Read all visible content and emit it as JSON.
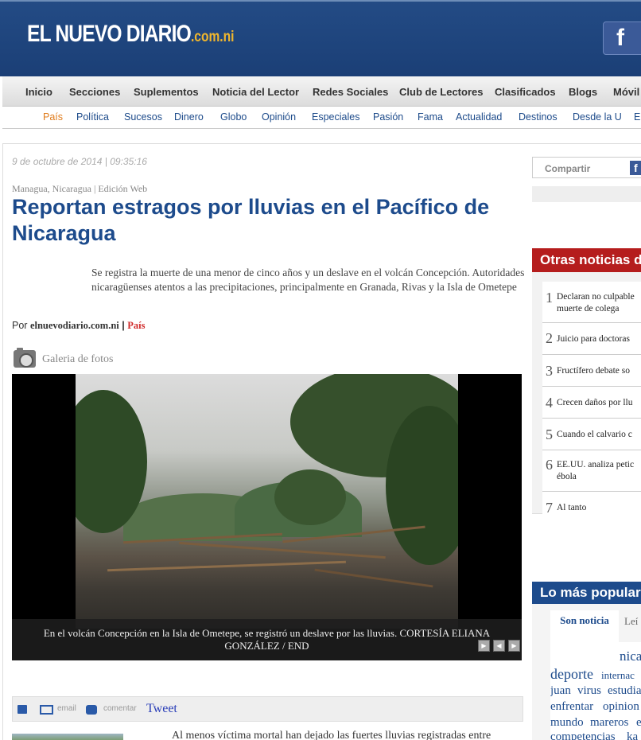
{
  "header": {
    "logo_main": "EL NUEVO DIARIO",
    "logo_domain": ".com.ni",
    "facebook_glyph": "f"
  },
  "main_nav": [
    "Inicio",
    "Secciones",
    "Suplementos",
    "Noticia del Lector",
    "Redes Sociales",
    "Club de Lectores",
    "Clasificados",
    "Blogs",
    "Móvil"
  ],
  "sub_nav": [
    "País",
    "Política",
    "Sucesos",
    "Dinero",
    "Globo",
    "Opinión",
    "Especiales",
    "Pasión",
    "Fama",
    "Actualidad",
    "Destinos",
    "Desde la U",
    "En"
  ],
  "sub_nav_active": "País",
  "article": {
    "date": "9 de octubre de 2014 | 09:35:16",
    "location": "Managua, Nicaragua | Edición Web",
    "headline": "Reportan estragos por lluvias en el Pacífico de Nicaragua",
    "summary": "Se registra la muerte de una menor de cinco años y un deslave en el volcán Concepción. Autoridades nicaragüenses atentos a las precipitaciones, principalmente en Granada, Rivas y la Isla de Ometepe",
    "byline_prefix": "Por",
    "byline_site": "elnuevodiario.com.ni",
    "byline_sep": "|",
    "byline_section": "País",
    "gallery_label": "Galeria de fotos",
    "caption": "En el volcán Concepción en la Isla de Ometepe, se registró un deslave por las lluvias. CORTESÍA ELIANA GONZÁLEZ / END",
    "body_start": "Al menos víctima mortal han dejado las fuertes lluvias registradas entre"
  },
  "share_bar": {
    "email": "email",
    "comment": "comentar",
    "tweet": "Tweet"
  },
  "sidebar": {
    "share_label": "Compartir",
    "share_fb": "f",
    "otras_title": "Otras noticias d",
    "otras": [
      {
        "num": "1",
        "text_line1": "Declaran no culpable",
        "text_line2": "muerte de colega"
      },
      {
        "num": "2",
        "text_line1": "Juicio para doctoras",
        "text_line2": ""
      },
      {
        "num": "3",
        "text_line1": "Fructífero debate so",
        "text_line2": ""
      },
      {
        "num": "4",
        "text_line1": "Crecen daños por llu",
        "text_line2": ""
      },
      {
        "num": "5",
        "text_line1": "Cuando el calvario c",
        "text_line2": ""
      },
      {
        "num": "6",
        "text_line1": "EE.UU. analiza petic",
        "text_line2": "ébola"
      },
      {
        "num": "7",
        "text_line1": "Al tanto",
        "text_line2": ""
      }
    ],
    "popular_title": "Lo más popular",
    "tab_active": "Son noticia",
    "tab_other": "Leí",
    "tags": [
      "nica",
      "deporte",
      "internac",
      "juan",
      "virus",
      "estudia",
      "enfrentar",
      "opinion",
      "mundo",
      "mareros",
      "e",
      "competencias",
      "ka"
    ]
  },
  "colors": {
    "brand_blue": "#1d4b8c",
    "header_bg": "#234b85",
    "accent_red": "#b51d1d",
    "logo_gold": "#f0b62d",
    "nav_active_orange": "#e07b1b"
  }
}
